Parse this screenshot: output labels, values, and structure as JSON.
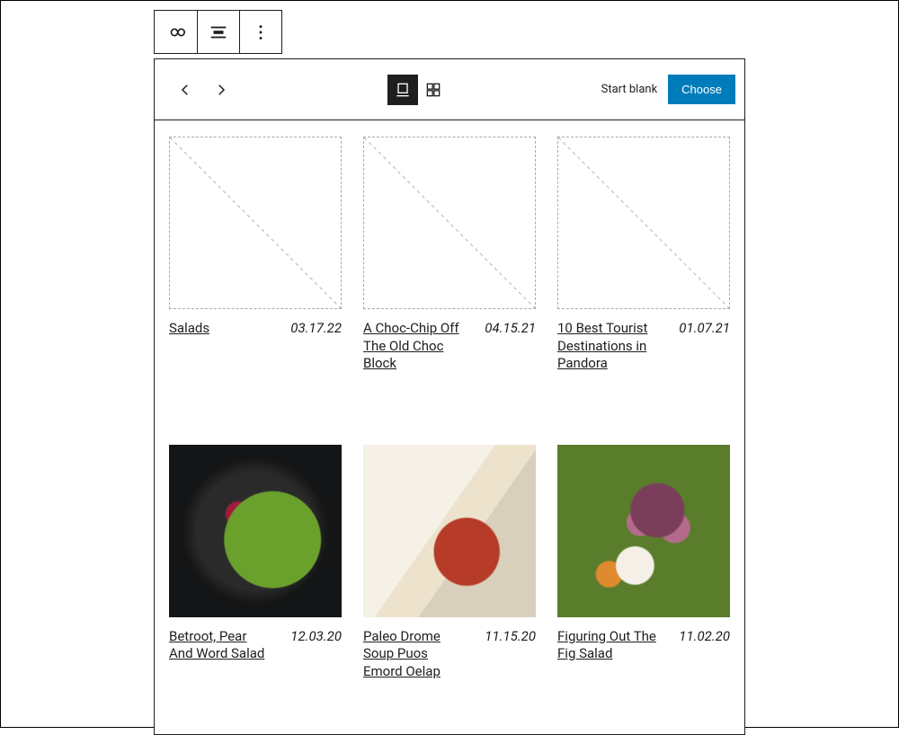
{
  "toolbar": {
    "buttons": [
      "link-icon",
      "align-icon",
      "more-icon"
    ]
  },
  "header": {
    "start_blank_label": "Start blank",
    "choose_label": "Choose",
    "views": [
      "carousel",
      "grid"
    ],
    "active_view": "carousel"
  },
  "posts": [
    {
      "title": "Salads",
      "date": "03.17.22",
      "image": null
    },
    {
      "title": "A Choc-Chip Off The Old Choc Block",
      "date": "04.15.21",
      "image": null
    },
    {
      "title": "10 Best Tourist Destinations in Pandora",
      "date": "01.07.21",
      "image": null
    },
    {
      "title": "Betroot, Pear And Word Salad",
      "date": "12.03.20",
      "image": "img1"
    },
    {
      "title": "Paleo Drome Soup Puos Emord Oelap",
      "date": "11.15.20",
      "image": "img2"
    },
    {
      "title": "Figuring Out The Fig Salad",
      "date": "11.02.20",
      "image": "img3"
    }
  ]
}
